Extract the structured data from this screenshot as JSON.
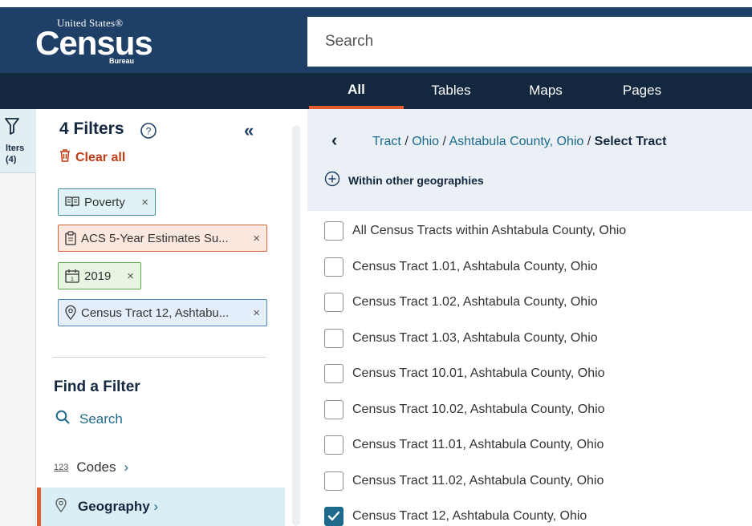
{
  "header": {
    "logo": {
      "top": "United States®",
      "main": "Census",
      "bottom": "Bureau"
    },
    "search_placeholder": "Search",
    "tabs": [
      {
        "label": "All",
        "active": true
      },
      {
        "label": "Tables",
        "active": false
      },
      {
        "label": "Maps",
        "active": false
      },
      {
        "label": "Pages",
        "active": false
      }
    ]
  },
  "strip": {
    "label_line1": "lters",
    "label_line2": "(4)"
  },
  "filters": {
    "title": "4 Filters",
    "clear_all": "Clear all",
    "chips": [
      {
        "label": "Poverty",
        "icon": "book-icon",
        "remove": "×"
      },
      {
        "label": "ACS 5-Year Estimates Su...",
        "icon": "clipboard-icon",
        "remove": "×"
      },
      {
        "label": "2019",
        "icon": "calendar-icon",
        "remove": "×"
      },
      {
        "label": "Census Tract 12, Ashtabu...",
        "icon": "location-pin-icon",
        "remove": "×"
      }
    ],
    "find_title": "Find a Filter",
    "search_label": "Search",
    "codes_label": "Codes",
    "codes_icon_text": "123",
    "geography_label": "Geography"
  },
  "main": {
    "breadcrumb": {
      "items": [
        "Tract",
        "Ohio",
        "Ashtabula County, Ohio"
      ],
      "separator": "/",
      "current": "Select Tract"
    },
    "within_label": "Within other geographies",
    "options": [
      {
        "label": "All Census Tracts within Ashtabula County, Ohio",
        "checked": false
      },
      {
        "label": "Census Tract 1.01, Ashtabula County, Ohio",
        "checked": false
      },
      {
        "label": "Census Tract 1.02, Ashtabula County, Ohio",
        "checked": false
      },
      {
        "label": "Census Tract 1.03, Ashtabula County, Ohio",
        "checked": false
      },
      {
        "label": "Census Tract 10.01, Ashtabula County, Ohio",
        "checked": false
      },
      {
        "label": "Census Tract 10.02, Ashtabula County, Ohio",
        "checked": false
      },
      {
        "label": "Census Tract 11.01, Ashtabula County, Ohio",
        "checked": false
      },
      {
        "label": "Census Tract 11.02, Ashtabula County, Ohio",
        "checked": false
      },
      {
        "label": "Census Tract 12, Ashtabula County, Ohio",
        "checked": true
      }
    ]
  },
  "colors": {
    "header_bg": "#1e3f66",
    "nav_bg": "#13273f",
    "accent_orange": "#e15d2d",
    "link_teal": "#1e6a8c",
    "clear_red": "#c13b16"
  }
}
